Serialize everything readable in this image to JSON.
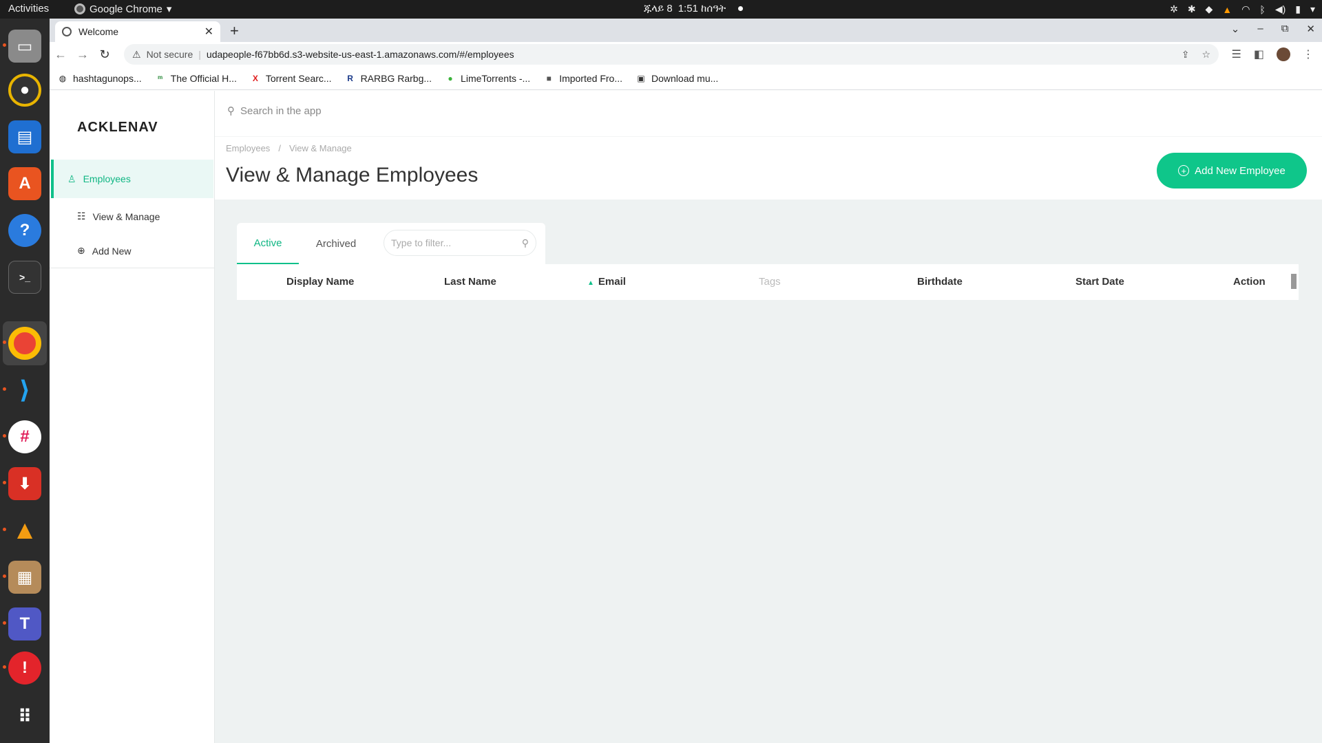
{
  "os_topbar": {
    "activities": "Activities",
    "app_name": "Google Chrome",
    "date": "ጁላይ 8",
    "time": "1:51 ከሰዓት"
  },
  "browser": {
    "tab_title": "Welcome",
    "security_label": "Not secure",
    "url": "udapeople-f67bb6d.s3-website-us-east-1.amazonaws.com/#/employees",
    "bookmarks": [
      {
        "label": "hashtagunops...",
        "icon": "globe-icon"
      },
      {
        "label": "The Official H...",
        "icon": "site-icon"
      },
      {
        "label": "Torrent Searc...",
        "icon": "x-icon"
      },
      {
        "label": "RARBG Rarbg...",
        "icon": "r-icon"
      },
      {
        "label": "LimeTorrents -...",
        "icon": "lime-icon"
      },
      {
        "label": "Imported Fro...",
        "icon": "folder-icon"
      },
      {
        "label": "Download mu...",
        "icon": "car-icon"
      }
    ]
  },
  "app": {
    "logo": "ACKLENAV",
    "search_placeholder": "Search in the app",
    "sidebar": {
      "section": "Employees",
      "items": [
        "View & Manage",
        "Add New"
      ]
    },
    "breadcrumb": [
      "Employees",
      "View & Manage"
    ],
    "page_title": "View & Manage Employees",
    "add_button": "Add New Employee",
    "tabs": [
      "Active",
      "Archived"
    ],
    "filter_placeholder": "Type to filter...",
    "columns": [
      "Display Name",
      "Last Name",
      "Email",
      "Tags",
      "Birthdate",
      "Start Date",
      "Action"
    ],
    "accent_color": "#0fc08a"
  }
}
